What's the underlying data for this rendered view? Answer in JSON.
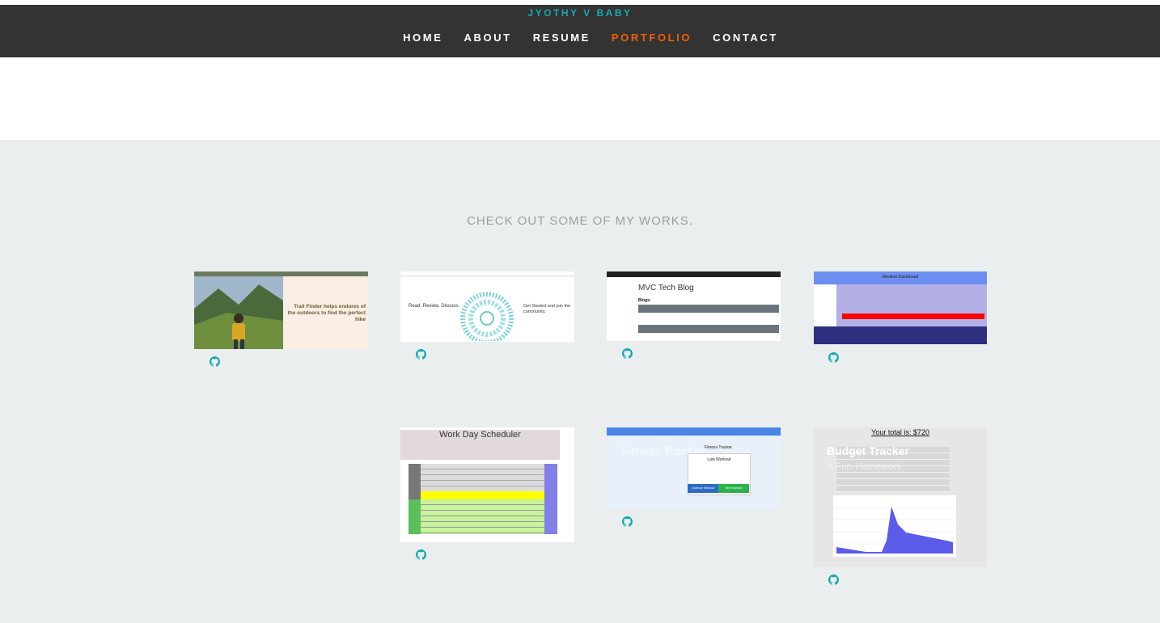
{
  "site": {
    "brand": "JYOTHY V BABY"
  },
  "nav": {
    "items": [
      {
        "label": "HOME"
      },
      {
        "label": "ABOUT"
      },
      {
        "label": "RESUME"
      },
      {
        "label": "PORTFOLIO",
        "active": true
      },
      {
        "label": "CONTACT"
      }
    ],
    "active_color": "#f06000"
  },
  "portfolio": {
    "heading": "CHECK OUT SOME OF MY WORKS.",
    "projects": [
      {
        "name": "trail-finder",
        "thumb_text": "Trail Finder helps endures of the outdoors to find the perfect hike"
      },
      {
        "name": "review-community",
        "thumb_text_left": "Read. Review. Discuss.",
        "thumb_text_right": "Get Started and join the community."
      },
      {
        "name": "mvc-tech-blog",
        "thumb_title": "MVC Tech Blog",
        "thumb_sub": "Blogs:"
      },
      {
        "name": "weather-dashboard",
        "thumb_title": "Weather Dashboard"
      },
      {
        "name": "work-day-scheduler",
        "thumb_title": "Work Day Scheduler"
      },
      {
        "name": "fitness-tracker",
        "thumb_title": "Fitness Tracker",
        "overlay_title": "Fitness Tracker",
        "popup_title": "Fitness Tracker",
        "popup_sub": "Last Workout",
        "btn_continue": "Continue Workout",
        "btn_new": "New Workout"
      },
      {
        "name": "budget-tracker",
        "thumb_title": "Your total is: $720",
        "overlay_title": "Budget Tracker",
        "overlay_sub": "A Fun-Homework"
      }
    ],
    "icon": "github-icon",
    "accent": "#11abb0"
  }
}
